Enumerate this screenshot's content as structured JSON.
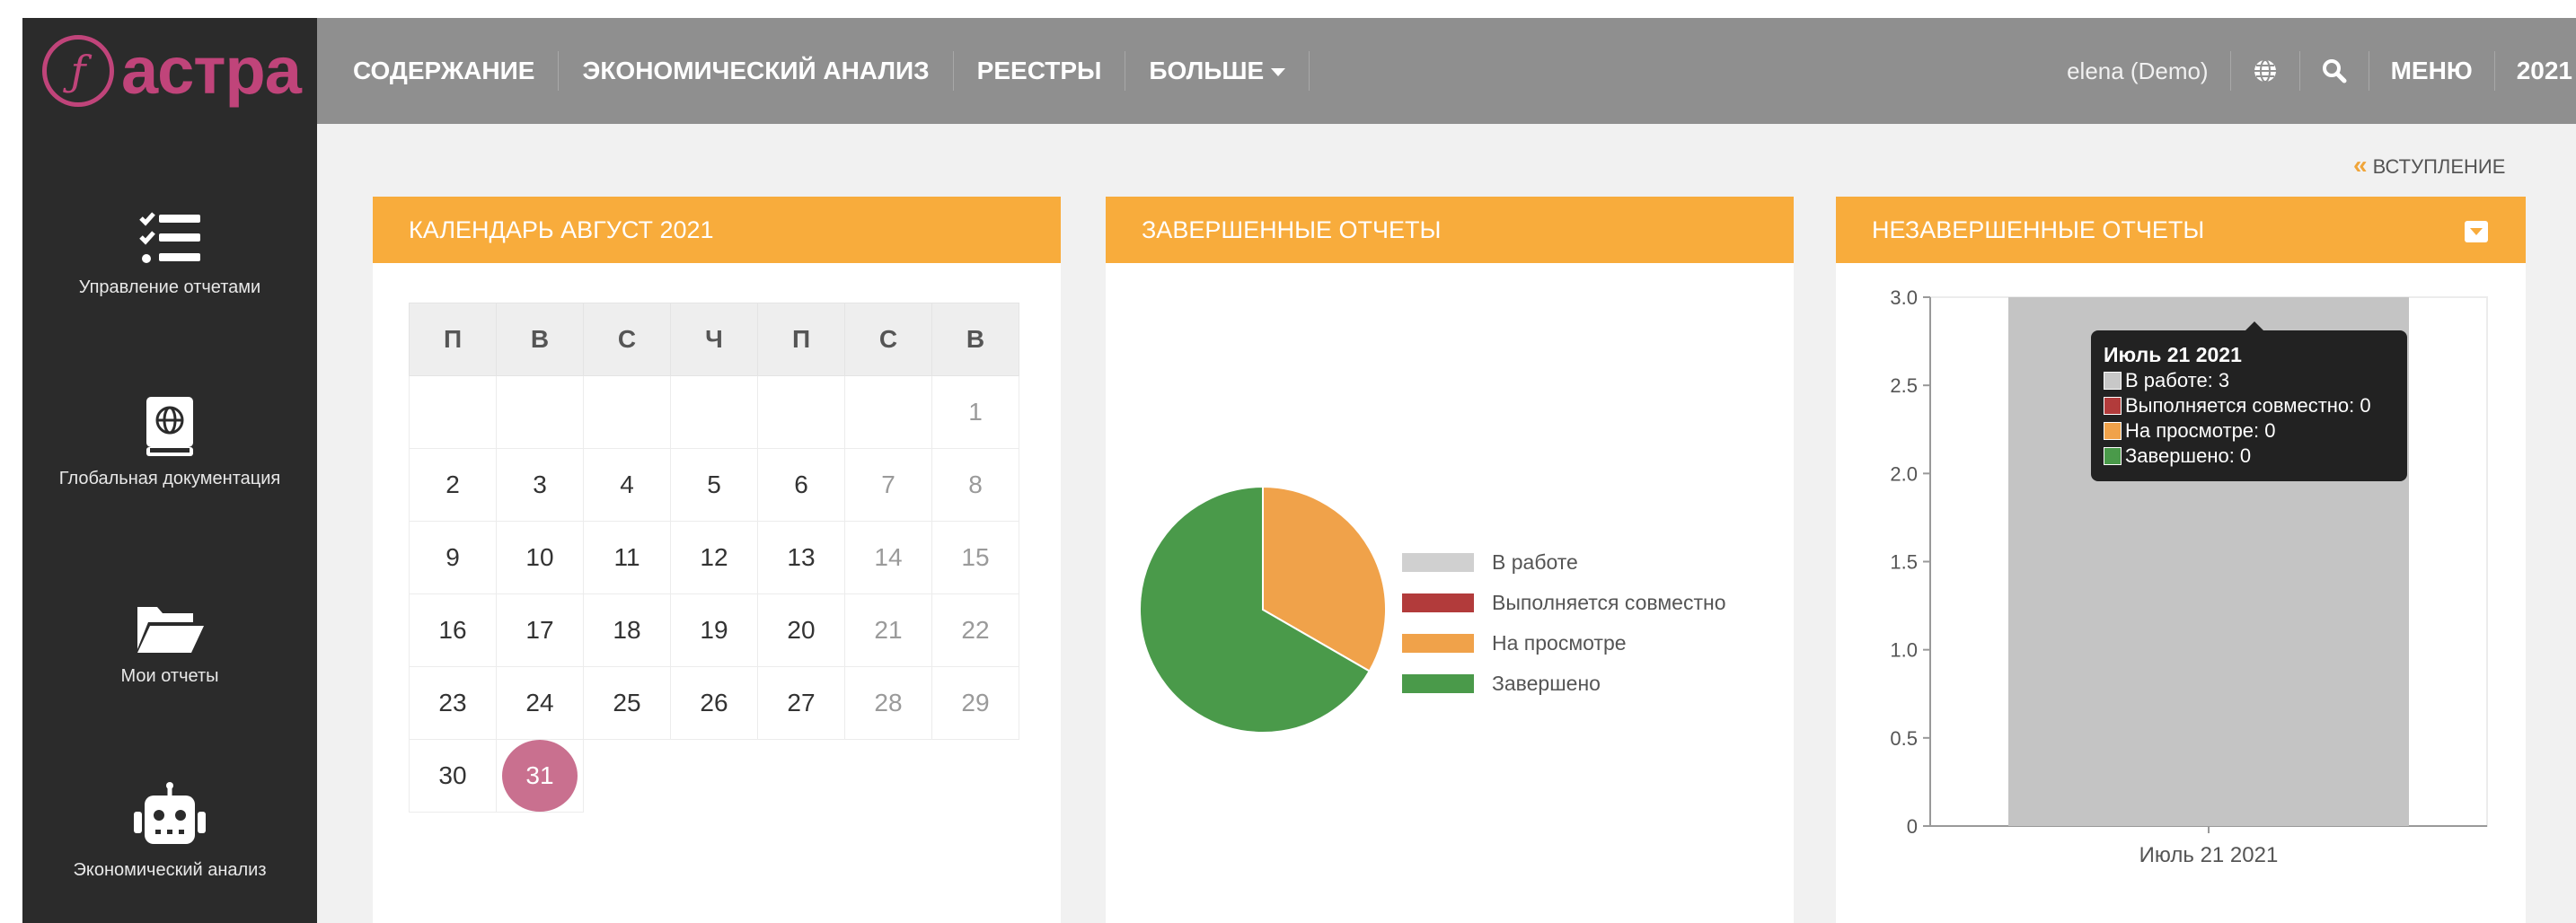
{
  "brand": {
    "logo_text": "астра",
    "logo_glyph": "ƒ",
    "accent": "#c0447a"
  },
  "sidebar": {
    "items": [
      {
        "label": "Управление отчетами",
        "icon": "checklist-icon"
      },
      {
        "label": "Глобальная документация",
        "icon": "globe-book-icon"
      },
      {
        "label": "Мои отчеты",
        "icon": "folder-open-icon"
      },
      {
        "label": "Экономический анализ",
        "icon": "robot-icon"
      }
    ]
  },
  "topnav": {
    "items": [
      "СОДЕРЖАНИЕ",
      "ЭКОНОМИЧЕСКИЙ АНАЛИЗ",
      "РЕЕСТРЫ",
      "БОЛЬШЕ"
    ],
    "user": "elena (Demo)",
    "menu_label": "МЕНЮ",
    "year": "2021"
  },
  "intro_link": "ВСТУПЛЕНИЕ",
  "calendar": {
    "title": "КАЛЕНДАРЬ АВГУСТ 2021",
    "weekdays": [
      "П",
      "В",
      "С",
      "Ч",
      "П",
      "С",
      "В"
    ],
    "weeks": [
      [
        "",
        "",
        "",
        "",
        "",
        "",
        "1"
      ],
      [
        "2",
        "3",
        "4",
        "5",
        "6",
        "7",
        "8"
      ],
      [
        "9",
        "10",
        "11",
        "12",
        "13",
        "14",
        "15"
      ],
      [
        "16",
        "17",
        "18",
        "19",
        "20",
        "21",
        "22"
      ],
      [
        "23",
        "24",
        "25",
        "26",
        "27",
        "28",
        "29"
      ],
      [
        "30",
        "31",
        "",
        "",
        "",
        "",
        ""
      ]
    ],
    "today": "31"
  },
  "completed_panel": {
    "title": "ЗАВЕРШЕННЫЕ ОТЧЕТЫ"
  },
  "incomplete_panel": {
    "title": "НЕЗАВЕРШЕННЫЕ ОТЧЕТЫ"
  },
  "tooltip": {
    "title": "Июль 21 2021",
    "rows": [
      {
        "label": "В работе: 3",
        "color": "#c8c8c8"
      },
      {
        "label": "Выполняется совместно: 0",
        "color": "#b23b3b"
      },
      {
        "label": "На просмотре: 0",
        "color": "#f0a24a"
      },
      {
        "label": "Завершено: 0",
        "color": "#4a9a4a"
      }
    ]
  },
  "chart_data": [
    {
      "type": "pie",
      "labels": [
        "В работе",
        "Выполняется совместно",
        "На просмотре",
        "Завершено"
      ],
      "values": [
        0,
        0,
        1,
        2
      ],
      "colors": [
        "#d0d0d0",
        "#b23b3b",
        "#f0a24a",
        "#4a9a4a"
      ],
      "legend": "right"
    },
    {
      "type": "bar",
      "categories": [
        "Июль 21 2021"
      ],
      "series": [
        {
          "name": "В работе",
          "values": [
            3
          ],
          "color": "#c4c4c4"
        },
        {
          "name": "Выполняется совместно",
          "values": [
            0
          ],
          "color": "#b23b3b"
        },
        {
          "name": "На просмотре",
          "values": [
            0
          ],
          "color": "#f0a24a"
        },
        {
          "name": "Завершено",
          "values": [
            0
          ],
          "color": "#4a9a4a"
        }
      ],
      "ylim": [
        0,
        3
      ],
      "yticks": [
        "0",
        "0.5",
        "1.0",
        "1.5",
        "2.0",
        "2.5",
        "3.0"
      ],
      "grid": false
    }
  ]
}
